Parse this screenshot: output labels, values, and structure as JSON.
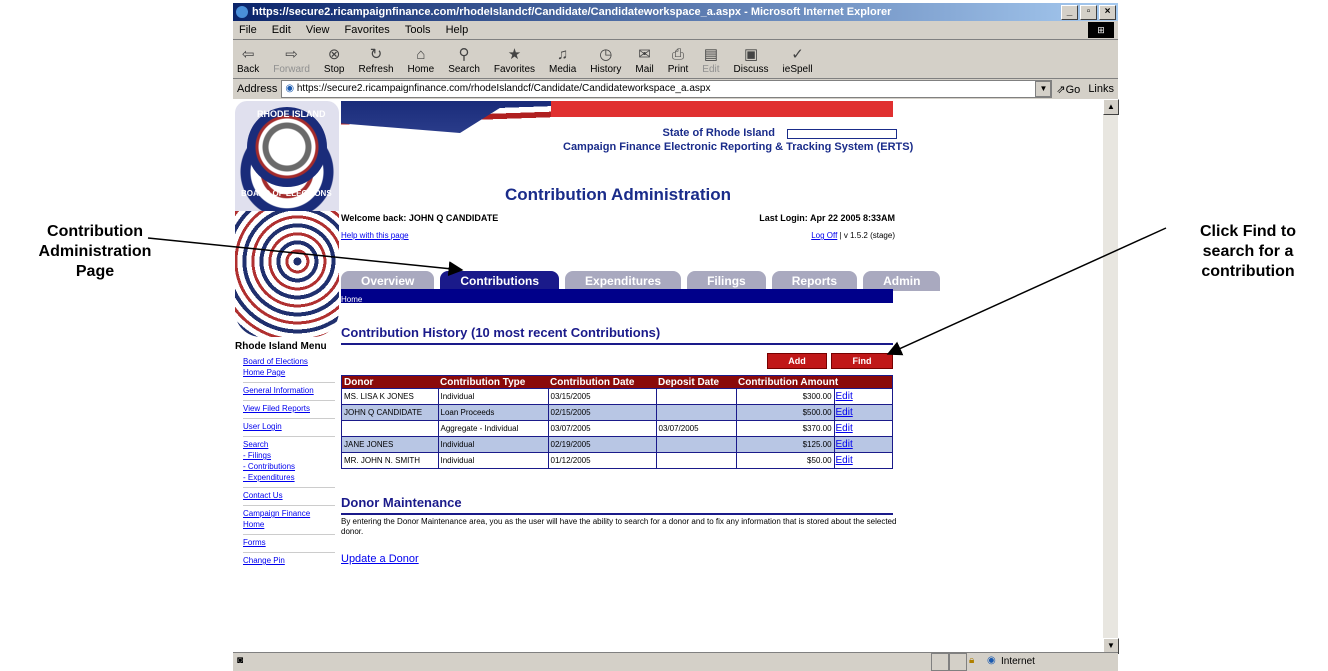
{
  "callouts": {
    "left": [
      "Contribution",
      "Administration",
      "Page"
    ],
    "right": [
      "Click Find to",
      "search for a",
      "contribution"
    ]
  },
  "window": {
    "title": "https://secure2.ricampaignfinance.com/rhodeIslandcf/Candidate/Candidateworkspace_a.aspx - Microsoft Internet Explorer",
    "menu": [
      "File",
      "Edit",
      "View",
      "Favorites",
      "Tools",
      "Help"
    ],
    "toolbar": [
      {
        "label": "Back",
        "icon": "back-arrow"
      },
      {
        "label": "Forward",
        "icon": "forward-arrow"
      },
      {
        "label": "Stop",
        "icon": "stop"
      },
      {
        "label": "Refresh",
        "icon": "refresh"
      },
      {
        "label": "Home",
        "icon": "home"
      },
      {
        "label": "Search",
        "icon": "search"
      },
      {
        "label": "Favorites",
        "icon": "favorites"
      },
      {
        "label": "Media",
        "icon": "media"
      },
      {
        "label": "History",
        "icon": "history"
      },
      {
        "label": "Mail",
        "icon": "mail"
      },
      {
        "label": "Print",
        "icon": "print"
      },
      {
        "label": "Edit",
        "icon": "edit"
      },
      {
        "label": "Discuss",
        "icon": "discuss"
      },
      {
        "label": "ieSpell",
        "icon": "spell"
      }
    ],
    "address_label": "Address",
    "address_url": "https://secure2.ricampaignfinance.com/rhodeIslandcf/Candidate/Candidateworkspace_a.aspx",
    "go_label": "Go",
    "links_label": "Links",
    "status_zone": "Internet"
  },
  "page": {
    "seal_text": {
      "top": "RHODE ISLAND",
      "bottom": "BOARD OF ELECTIONS"
    },
    "state_label": "State of Rhode Island",
    "system_name": "Campaign Finance Electronic Reporting & Tracking System (ERTS)",
    "title": "Contribution Administration",
    "welcome": "Welcome back: JOHN Q CANDIDATE",
    "last_login": "Last Login: Apr 22 2005 8:33AM",
    "help_link": "Help with this page",
    "logoff_link": "Log Off",
    "version": " | v 1.5.2 (stage)",
    "tabs": [
      "Overview",
      "Contributions",
      "Expenditures",
      "Filings",
      "Reports",
      "Admin"
    ],
    "active_tab": "Contributions",
    "breadcrumb": "Home",
    "left_menu": {
      "heading": "Rhode Island Menu",
      "items": [
        "Board of Elections",
        "Home Page",
        "General Information",
        "View Filed Reports",
        "User Login",
        "Search",
        "- Filings",
        "- Contributions",
        "- Expenditures",
        "Contact Us",
        "Campaign Finance",
        "Home",
        "Forms",
        "Change Pin"
      ]
    },
    "history_title": "Contribution History (10 most recent Contributions)",
    "add_label": "Add",
    "find_label": "Find",
    "table": {
      "headers": [
        "Donor",
        "Contribution Type",
        "Contribution Date",
        "Deposit Date",
        "Contribution Amount"
      ],
      "rows": [
        {
          "donor": "MS. LISA K JONES",
          "type": "Individual",
          "date": "03/15/2005",
          "deposit": "",
          "amount": "$300.00",
          "edit": "Edit"
        },
        {
          "donor": "JOHN Q CANDIDATE",
          "type": "Loan Proceeds",
          "date": "02/15/2005",
          "deposit": "",
          "amount": "$500.00",
          "edit": "Edit"
        },
        {
          "donor": "",
          "type": "Aggregate - Individual",
          "date": "03/07/2005",
          "deposit": "03/07/2005",
          "amount": "$370.00",
          "edit": "Edit"
        },
        {
          "donor": "JANE JONES",
          "type": "Individual",
          "date": "02/19/2005",
          "deposit": "",
          "amount": "$125.00",
          "edit": "Edit"
        },
        {
          "donor": "MR. JOHN N. SMITH",
          "type": "Individual",
          "date": "01/12/2005",
          "deposit": "",
          "amount": "$50.00",
          "edit": "Edit"
        }
      ]
    },
    "donor_title": "Donor Maintenance",
    "donor_text": "By entering the Donor Maintenance area, you as the user will have the ability to search for a donor and to fix any information that is stored about the selected donor.",
    "update_link": "Update a Donor"
  }
}
